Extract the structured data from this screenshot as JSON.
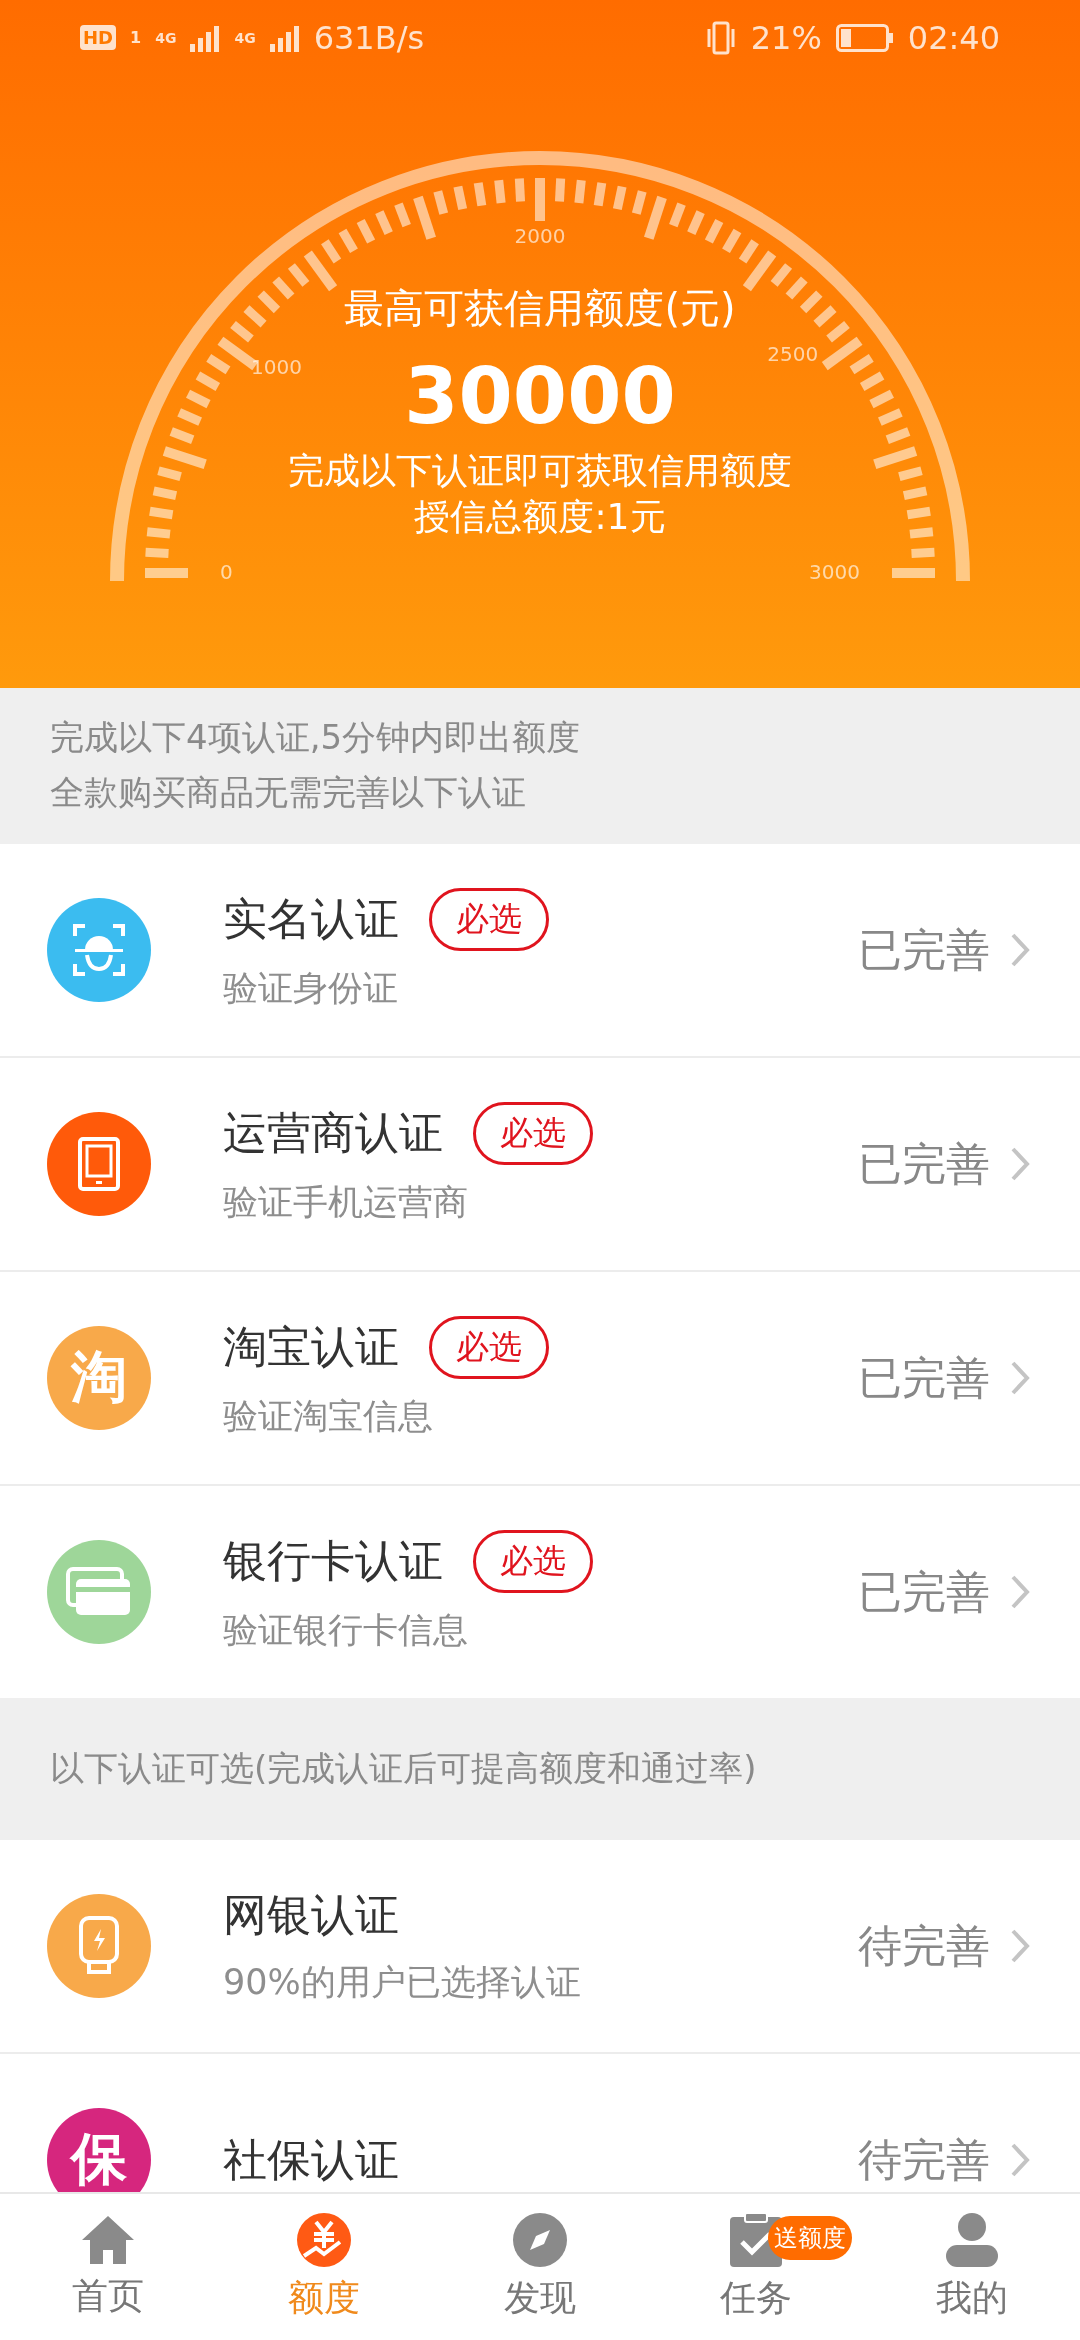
{
  "status_bar": {
    "hd": "HD",
    "sim": "1",
    "networks": [
      "4G",
      "4G"
    ],
    "speed": "631B/s",
    "battery": "21%",
    "time": "02:40"
  },
  "gauge": {
    "scale_labels": [
      "0",
      "1000",
      "2000",
      "2500",
      "3000"
    ],
    "title": "最高可获信用额度(元)",
    "amount": "30000",
    "hint": "完成以下认证即可获取信用额度",
    "total": "授信总额度:1元"
  },
  "notice": [
    "完成以下4项认证,5分钟内即出额度",
    "全款购买商品无需完善以下认证"
  ],
  "required_items": [
    {
      "kind": "face",
      "color": "#3bbcf0",
      "title": "实名认证",
      "tag": "必选",
      "subtitle": "验证身份证",
      "status": "已完善"
    },
    {
      "kind": "tablet",
      "color": "#ff5a0a",
      "title": "运营商认证",
      "tag": "必选",
      "subtitle": "验证手机运营商",
      "status": "已完善"
    },
    {
      "kind": "char",
      "glyph": "淘",
      "color": "#f8a94a",
      "title": "淘宝认证",
      "tag": "必选",
      "subtitle": "验证淘宝信息",
      "status": "已完善"
    },
    {
      "kind": "cards",
      "color": "#9ed699",
      "title": "银行卡认证",
      "tag": "必选",
      "subtitle": "验证银行卡信息",
      "status": "已完善"
    }
  ],
  "optional_header": "以下认证可选(完成认证后可提高额度和通过率)",
  "optional_items": [
    {
      "kind": "bolt",
      "color": "#f8a94a",
      "title": "网银认证",
      "subtitle": "90%的用户已选择认证",
      "status": "待完善"
    },
    {
      "kind": "char",
      "glyph": "保",
      "color": "#d6267e",
      "title": "社保认证",
      "status": "待完善"
    }
  ],
  "tab_bar": [
    {
      "kind": "home",
      "label": "首页",
      "selected": false
    },
    {
      "kind": "yen",
      "label": "额度",
      "selected": true
    },
    {
      "kind": "compass",
      "label": "发现",
      "selected": false
    },
    {
      "kind": "task",
      "label": "任务",
      "badge": "送额度",
      "selected": false
    },
    {
      "kind": "person",
      "label": "我的",
      "selected": false
    }
  ]
}
